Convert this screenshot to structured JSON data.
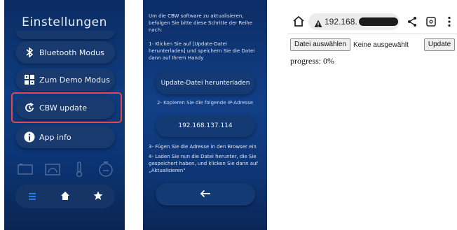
{
  "panel1": {
    "title": "Einstellungen",
    "menu": [
      {
        "label": "Bluetooth Modus",
        "icon": "bluetooth-icon"
      },
      {
        "label": "Zum Demo Modus",
        "icon": "demo-mode-icon"
      },
      {
        "label": "CBW update",
        "icon": "update-icon"
      },
      {
        "label": "App info",
        "icon": "info-icon"
      }
    ],
    "highlight_color": "#e0484d",
    "status_icons": [
      "battery-icon",
      "signal-icon",
      "thermometer-icon",
      "clock-icon"
    ],
    "nav_icons": [
      "menu-icon",
      "home-icon",
      "star-icon"
    ],
    "accent": "#2b7be0"
  },
  "panel2": {
    "intro": "Um die CBW software zu aktualisieren, befolgen Sie bitte diese Schritte der Reihe nach:",
    "step1": "1- Klicken Sie auf [Update-Datei herunterladen] und speichern Sie die Datei dann auf Ihrem Handy",
    "download_label": "Update-Datei herunterladen",
    "step2": "2- Kopieren Sie die folgende IP-Adresse",
    "ip_address": "192.168.137.114",
    "step3": "3- Fügen Sie die Adresse in den Browser ein",
    "step4": "4- Laden Sie nun die Datei herunter, die Sie gespeichert haben, und klicken Sie dann auf „Aktualisieren\"",
    "back_icon": "arrow-left-icon"
  },
  "panel3": {
    "url_host": "192.168.",
    "choose_file_label": "Datei auswählen",
    "no_file_text": "Keine ausgewählt",
    "update_label": "Update",
    "progress_text": "progress: 0%"
  }
}
